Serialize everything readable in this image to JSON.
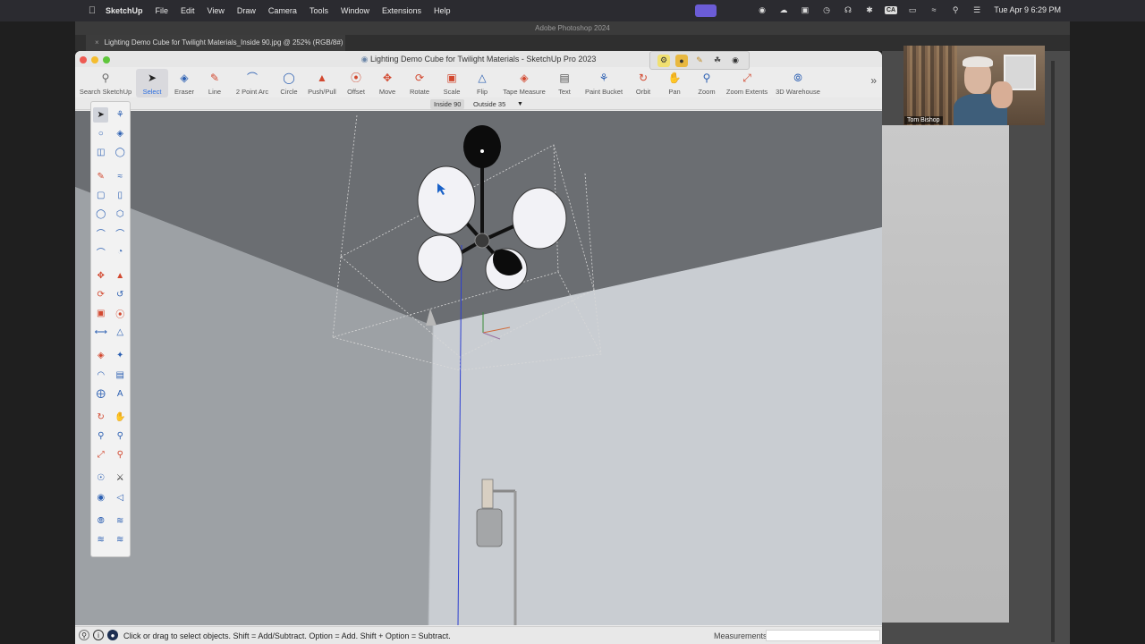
{
  "menubar": {
    "app_name": "SketchUp",
    "items": [
      "File",
      "Edit",
      "View",
      "Draw",
      "Camera",
      "Tools",
      "Window",
      "Extensions",
      "Help"
    ],
    "status_icons": [
      "grammarly-icon",
      "wifi-cloud-icon",
      "display-icon",
      "clock-icon",
      "headphones-icon",
      "bluetooth-icon",
      "keyboard-icon",
      "battery-icon",
      "wifi-icon",
      "search-icon",
      "control-center-icon"
    ],
    "keyboard_label": "CA",
    "clock": "Tue Apr 9  6:29 PM"
  },
  "photoshop": {
    "window_title": "Adobe Photoshop 2024",
    "tab_label": "Lighting Demo Cube for Twilight Materials_Inside 90.jpg @ 252% (RGB/8#)"
  },
  "video": {
    "participant_name": "Tom Bishop"
  },
  "sketchup": {
    "window_title": "Lighting Demo Cube for Twilight Materials - SketchUp Pro 2023",
    "toolbar": [
      {
        "label": "Search SketchUp",
        "icon": "search-icon"
      },
      {
        "label": "Select",
        "icon": "select-arrow-icon"
      },
      {
        "label": "Eraser",
        "icon": "eraser-icon"
      },
      {
        "label": "Line",
        "icon": "pencil-icon"
      },
      {
        "label": "2 Point Arc",
        "icon": "arc-icon"
      },
      {
        "label": "Circle",
        "icon": "circle-icon"
      },
      {
        "label": "Push/Pull",
        "icon": "push-pull-icon"
      },
      {
        "label": "Offset",
        "icon": "offset-icon"
      },
      {
        "label": "Move",
        "icon": "move-icon"
      },
      {
        "label": "Rotate",
        "icon": "rotate-icon"
      },
      {
        "label": "Scale",
        "icon": "scale-icon"
      },
      {
        "label": "Flip",
        "icon": "flip-icon"
      },
      {
        "label": "Tape Measure",
        "icon": "tape-measure-icon"
      },
      {
        "label": "Text",
        "icon": "text-icon"
      },
      {
        "label": "Paint Bucket",
        "icon": "paint-bucket-icon"
      },
      {
        "label": "Orbit",
        "icon": "orbit-icon"
      },
      {
        "label": "Pan",
        "icon": "pan-icon"
      },
      {
        "label": "Zoom",
        "icon": "zoom-icon"
      },
      {
        "label": "Zoom Extents",
        "icon": "zoom-extents-icon"
      },
      {
        "label": "3D Warehouse",
        "icon": "warehouse-icon"
      }
    ],
    "active_tool": "Select",
    "scenes": [
      "Inside 90",
      "Outside 35"
    ],
    "active_scene": "Inside 90",
    "status_text": "Click or drag to select objects. Shift = Add/Subtract. Option = Add. Shift + Option = Subtract.",
    "measurements_label": "Measurements",
    "measurements_value": ""
  },
  "colors": {
    "accent": "#2a6ee0",
    "ceiling": "#6b6e72",
    "wall_right": "#c8ccd1",
    "wall_left": "#a9adb1"
  }
}
